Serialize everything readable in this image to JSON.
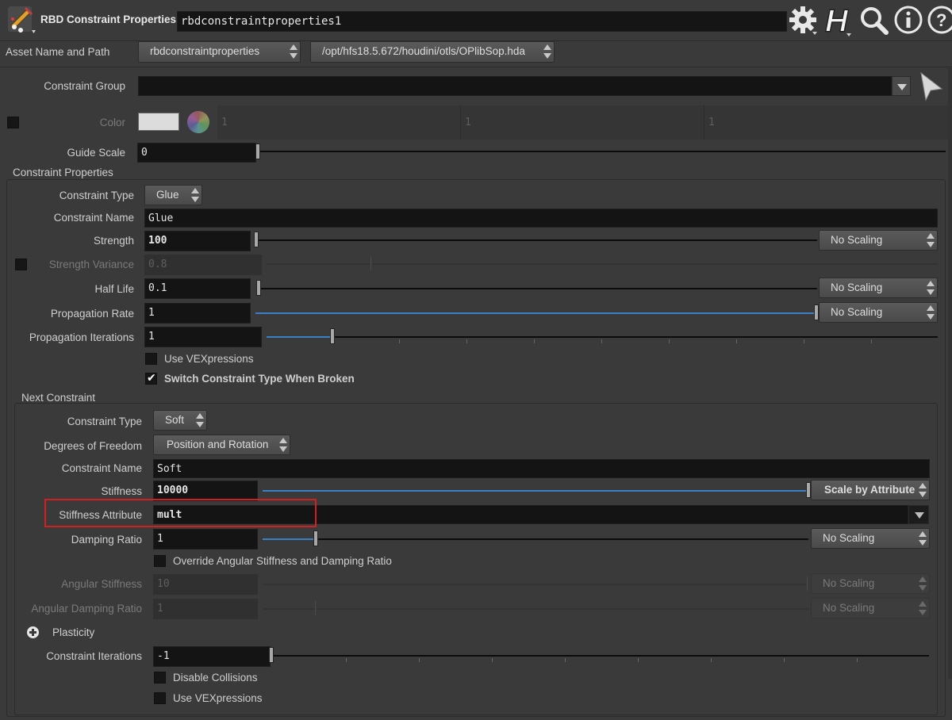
{
  "header": {
    "node_type": "RBD Constraint Properties",
    "node_name": "rbdconstraintproperties1",
    "icons": [
      "rbd-node-icon",
      "gear-icon",
      "houdini-h-icon",
      "search-icon",
      "info-icon",
      "help-icon"
    ]
  },
  "asset": {
    "label": "Asset Name and Path",
    "name": "rbdconstraintproperties",
    "path": "/opt/hfs18.5.672/houdini/otls/OPlibSop.hda"
  },
  "top": {
    "constraint_group_label": "Constraint Group",
    "constraint_group_value": "",
    "color_label": "Color",
    "color_values": [
      "1",
      "1",
      "1"
    ],
    "guide_scale_label": "Guide Scale",
    "guide_scale_value": "0"
  },
  "constraint_properties": {
    "title": "Constraint Properties",
    "constraint_type_label": "Constraint Type",
    "constraint_type_value": "Glue",
    "constraint_name_label": "Constraint Name",
    "constraint_name_value": "Glue",
    "strength_label": "Strength",
    "strength_value": "100",
    "strength_scaling": "No Scaling",
    "strength_variance_label": "Strength Variance",
    "strength_variance_value": "0.8",
    "half_life_label": "Half Life",
    "half_life_value": "0.1",
    "half_life_scaling": "No Scaling",
    "propagation_rate_label": "Propagation Rate",
    "propagation_rate_value": "1",
    "propagation_rate_scaling": "No Scaling",
    "propagation_iterations_label": "Propagation Iterations",
    "propagation_iterations_value": "1",
    "use_vexpressions_label": "Use VEXpressions",
    "switch_type_label": "Switch Constraint Type When Broken"
  },
  "next_constraint": {
    "title": "Next Constraint",
    "constraint_type_label": "Constraint Type",
    "constraint_type_value": "Soft",
    "dof_label": "Degrees of Freedom",
    "dof_value": "Position and Rotation",
    "constraint_name_label": "Constraint Name",
    "constraint_name_value": "Soft",
    "stiffness_label": "Stiffness",
    "stiffness_value": "10000",
    "stiffness_scaling": "Scale by Attribute",
    "stiffness_attribute_label": "Stiffness Attribute",
    "stiffness_attribute_value": "mult",
    "damping_ratio_label": "Damping Ratio",
    "damping_ratio_value": "1",
    "damping_ratio_scaling": "No Scaling",
    "override_label": "Override Angular Stiffness and Damping Ratio",
    "angular_stiffness_label": "Angular Stiffness",
    "angular_stiffness_value": "10",
    "angular_stiffness_scaling": "No Scaling",
    "angular_damping_label": "Angular Damping Ratio",
    "angular_damping_value": "1",
    "angular_damping_scaling": "No Scaling",
    "plasticity_label": "Plasticity",
    "constraint_iterations_label": "Constraint Iterations",
    "constraint_iterations_value": "-1",
    "disable_collisions_label": "Disable Collisions",
    "use_vexpressions_label": "Use VEXpressions"
  },
  "colors": {
    "background": "#3a3a3a",
    "field": "#141414",
    "highlight_box": "#d21f1f",
    "slider_blue": "#3d7fc6"
  }
}
